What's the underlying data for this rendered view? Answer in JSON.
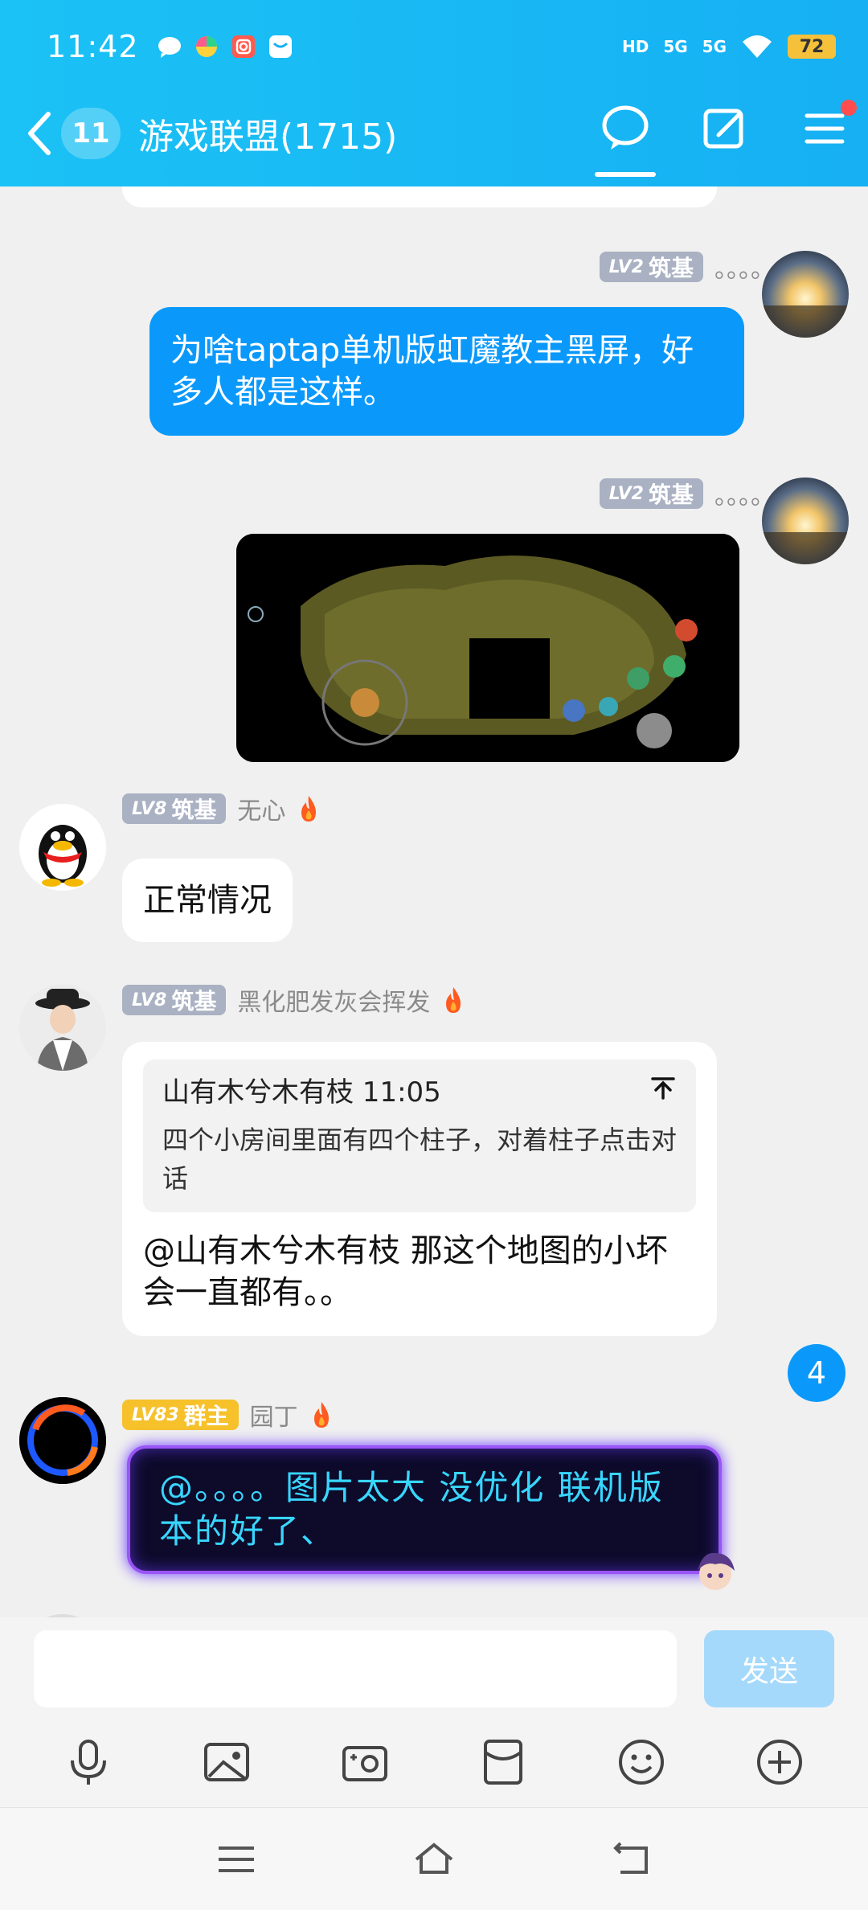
{
  "status_bar": {
    "time": "11:42",
    "signal_1": "5G",
    "signal_2": "5G",
    "battery": "72",
    "hd": "HD"
  },
  "header": {
    "unread_count": "11",
    "group_title": "游戏联盟(1715)"
  },
  "messages": [
    {
      "level": "LV2",
      "rank": "筑基",
      "name": "。。。。",
      "text": "为啥taptap单机版虹魔教主黑屏，好多人都是这样。"
    },
    {
      "level": "LV2",
      "rank": "筑基",
      "name": "。。。。",
      "image_alt": "game-screenshot"
    },
    {
      "level": "LV8",
      "rank": "筑基",
      "name": "无心",
      "text": "正常情况"
    },
    {
      "level": "LV8",
      "rank": "筑基",
      "name": "黑化肥发灰会挥发",
      "quote_author_time": "山有木兮木有枝 11:05",
      "quote_text": "四个小房间里面有四个柱子，对着柱子点击对话",
      "text": "@山有木兮木有枝 那这个地图的小坏会一直都有。。"
    },
    {
      "level": "LV83",
      "rank": "群主",
      "name": "园丁",
      "text": "@。。。。图片太大  没优化  联机版本的好了、"
    }
  ],
  "new_messages_badge": "4",
  "input": {
    "placeholder": "",
    "send_label": "发送"
  },
  "colors": {
    "header": "#16b0f3",
    "my_bubble": "#0a99fb",
    "send_disabled": "#a4d9fc"
  }
}
